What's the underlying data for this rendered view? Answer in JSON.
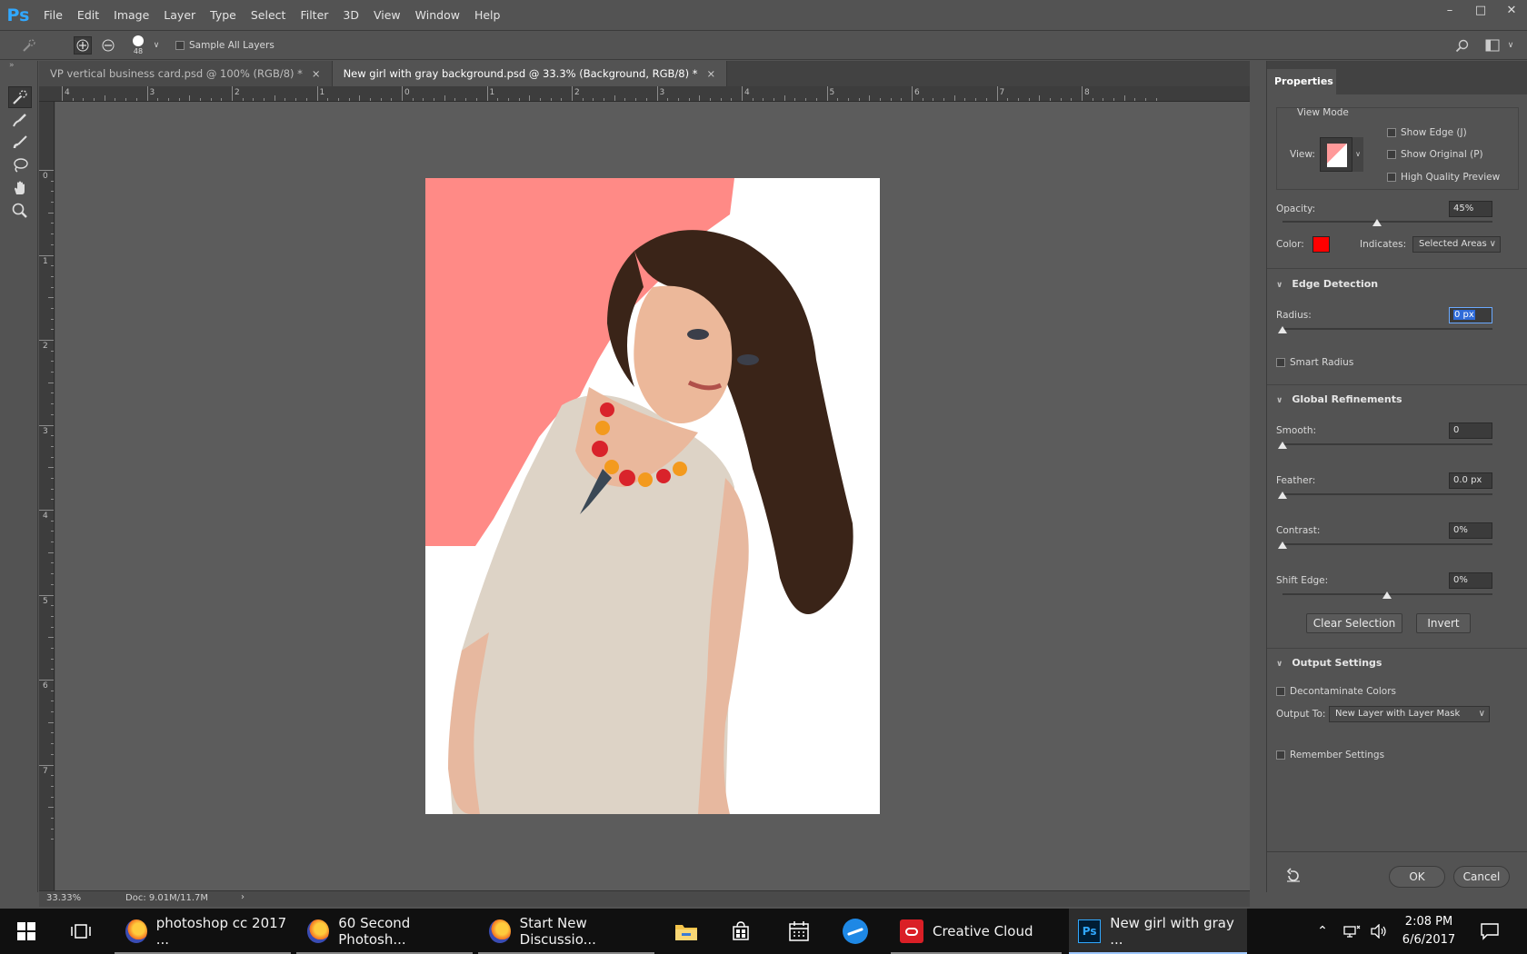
{
  "app": {
    "logo": "Ps",
    "menus": [
      "File",
      "Edit",
      "Image",
      "Layer",
      "Type",
      "Select",
      "Filter",
      "3D",
      "View",
      "Window",
      "Help"
    ]
  },
  "options": {
    "brush_size": "48",
    "sample_all_layers": "Sample All Layers"
  },
  "tabs": [
    {
      "label": "VP vertical business card.psd @ 100% (RGB/8) *",
      "close": "×"
    },
    {
      "label": "New girl with gray background.psd @ 33.3% (Background, RGB/8) *",
      "close": "×"
    }
  ],
  "ruler": {
    "top": [
      "4",
      "3",
      "2",
      "1",
      "0",
      "1",
      "2",
      "3",
      "4",
      "5",
      "6",
      "7",
      "8"
    ],
    "left": [
      "0",
      "1",
      "2",
      "3",
      "4",
      "5",
      "6",
      "7"
    ]
  },
  "status": {
    "zoom": "33.33%",
    "doc": "Doc: 9.01M/11.7M",
    "arrow": "›"
  },
  "properties": {
    "tab": "Properties",
    "view_mode": {
      "title": "View Mode",
      "view_label": "View:",
      "show_edge": "Show Edge (J)",
      "show_original": "Show Original (P)",
      "high_quality": "High Quality Preview"
    },
    "opacity_label": "Opacity:",
    "opacity_value": "45%",
    "opacity_fraction": 0.45,
    "color_label": "Color:",
    "overlay_color": "#ff0000",
    "indicates_label": "Indicates:",
    "indicates_value": "Selected Areas",
    "edge_detection": {
      "title": "Edge Detection",
      "radius_label": "Radius:",
      "radius_value": "0 px",
      "smart_radius": "Smart Radius"
    },
    "global_refinements": {
      "title": "Global Refinements",
      "smooth_label": "Smooth:",
      "smooth_value": "0",
      "feather_label": "Feather:",
      "feather_value": "0.0 px",
      "contrast_label": "Contrast:",
      "contrast_value": "0%",
      "shift_edge_label": "Shift Edge:",
      "shift_edge_value": "0%",
      "clear_selection": "Clear Selection",
      "invert": "Invert"
    },
    "output_settings": {
      "title": "Output Settings",
      "decontaminate": "Decontaminate Colors",
      "output_to_label": "Output To:",
      "output_to_value": "New Layer with Layer Mask"
    },
    "remember_settings": "Remember Settings",
    "ok": "OK",
    "cancel": "Cancel"
  },
  "taskbar": {
    "apps": [
      {
        "label": "photoshop cc 2017 ..."
      },
      {
        "label": "60 Second Photosh..."
      },
      {
        "label": "Start New Discussio..."
      },
      {
        "label": "Creative Cloud"
      },
      {
        "label": "New girl with gray ..."
      }
    ],
    "time": "2:08 PM",
    "date": "6/6/2017"
  }
}
